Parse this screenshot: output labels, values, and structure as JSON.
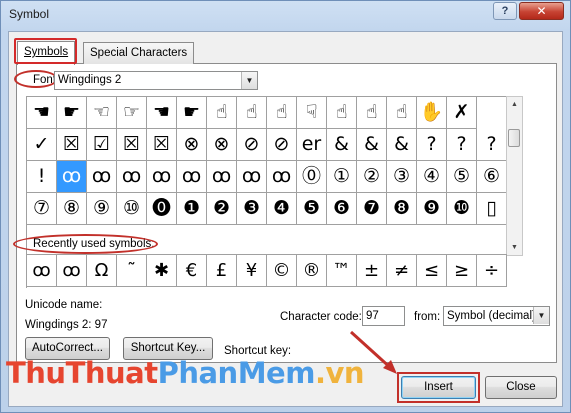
{
  "window": {
    "title": "Symbol",
    "help_label": "?",
    "close_label": "✕"
  },
  "tabs": [
    {
      "label": "Symbols",
      "active": true
    },
    {
      "label": "Special Characters",
      "active": false
    }
  ],
  "font": {
    "label": "Font:",
    "value": "Wingdings 2",
    "dropdown_icon": "chevron-down-icon"
  },
  "symbol_grid": {
    "rows": [
      [
        "☚",
        "☛",
        "☜",
        "☞",
        "☚",
        "☛",
        "☝",
        "☝",
        "☝",
        "☟",
        "☝",
        "☝",
        "☝",
        "✋",
        "✗"
      ],
      [
        "✓",
        "☒",
        "☑",
        "☒",
        "☒",
        "⊗",
        "⊗",
        "⊘",
        "⊘",
        "er",
        "&",
        "&",
        "&",
        "?",
        "?",
        "?"
      ],
      [
        "!",
        "ꝏ",
        "ꝏ",
        "ꝏ",
        "ꝏ",
        "ꝏ",
        "ꝏ",
        "ꝏ",
        "ꝏ",
        "⓪",
        "①",
        "②",
        "③",
        "④",
        "⑤",
        "⑥"
      ],
      [
        "⑦",
        "⑧",
        "⑨",
        "⑩",
        "⓿",
        "❶",
        "❷",
        "❸",
        "❹",
        "❺",
        "❻",
        "❼",
        "❽",
        "❾",
        "❿",
        "▯"
      ]
    ],
    "selected": {
      "row": 2,
      "col": 1
    }
  },
  "recently_used": {
    "label": "Recently used symbols:",
    "symbols": [
      "ꝏ",
      "ꝏ",
      "Ω",
      "˜",
      "✱",
      "€",
      "£",
      "¥",
      "©",
      "®",
      "™",
      "±",
      "≠",
      "≤",
      "≥",
      "÷"
    ]
  },
  "unicode_name": {
    "label": "Unicode name:",
    "value": "Wingdings 2: 97"
  },
  "character_code": {
    "label": "Character code:",
    "value": "97"
  },
  "from": {
    "label": "from:",
    "value": "Symbol (decimal)"
  },
  "buttons": {
    "autocorrect": "AutoCorrect...",
    "shortcut_key": "Shortcut Key...",
    "shortcut_key_label": "Shortcut key:",
    "insert": "Insert",
    "close": "Close"
  },
  "watermark": {
    "part1": "ThuThuat",
    "part2": "PhanMem",
    "part3": ".vn"
  },
  "colors": {
    "highlight": "#c2302a",
    "selection": "#3399ff",
    "window_frame": "#bcd1ea"
  }
}
